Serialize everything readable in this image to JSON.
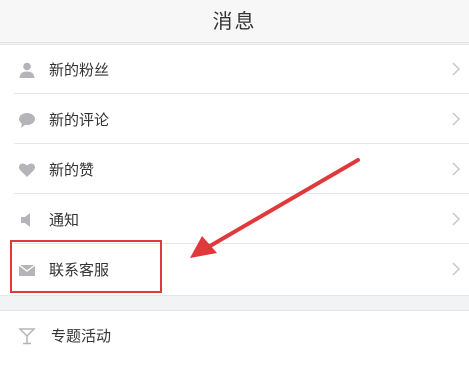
{
  "header": {
    "title": "消息"
  },
  "messages": {
    "items": [
      {
        "label": "新的粉丝",
        "icon": "person-icon"
      },
      {
        "label": "新的评论",
        "icon": "comment-icon"
      },
      {
        "label": "新的赞",
        "icon": "heart-icon"
      },
      {
        "label": "通知",
        "icon": "speaker-icon"
      },
      {
        "label": "联系客服",
        "icon": "mail-icon"
      }
    ]
  },
  "extra": {
    "items": [
      {
        "label": "专题活动",
        "icon": "cocktail-icon"
      }
    ]
  },
  "annotation": {
    "color": "#e0393b"
  }
}
